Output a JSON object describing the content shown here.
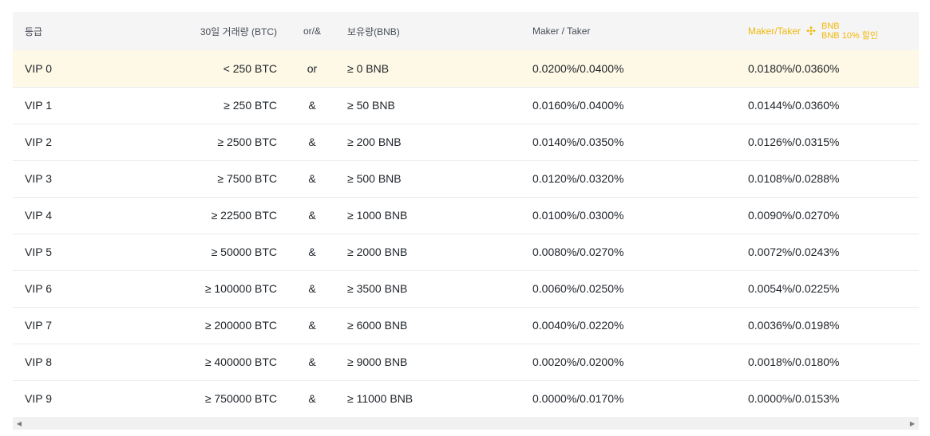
{
  "header": {
    "tier": "등급",
    "volume": "30일 거래량 (BTC)",
    "condition": "or/&",
    "holding": "보유량(BNB)",
    "maker_taker": "Maker / Taker",
    "bnb_maker_taker": "Maker/Taker",
    "bnb_line1": "BNB",
    "bnb_line2": "BNB 10% 할인"
  },
  "rows": [
    {
      "tier": "VIP 0",
      "volume": "< 250 BTC",
      "cond": "or",
      "bnb": "≥ 0 BNB",
      "fee": "0.0200%/0.0400%",
      "fee_bnb": "0.0180%/0.0360%"
    },
    {
      "tier": "VIP 1",
      "volume": "≥ 250 BTC",
      "cond": "&",
      "bnb": "≥ 50 BNB",
      "fee": "0.0160%/0.0400%",
      "fee_bnb": "0.0144%/0.0360%"
    },
    {
      "tier": "VIP 2",
      "volume": "≥ 2500 BTC",
      "cond": "&",
      "bnb": "≥ 200 BNB",
      "fee": "0.0140%/0.0350%",
      "fee_bnb": "0.0126%/0.0315%"
    },
    {
      "tier": "VIP 3",
      "volume": "≥ 7500 BTC",
      "cond": "&",
      "bnb": "≥ 500 BNB",
      "fee": "0.0120%/0.0320%",
      "fee_bnb": "0.0108%/0.0288%"
    },
    {
      "tier": "VIP 4",
      "volume": "≥ 22500 BTC",
      "cond": "&",
      "bnb": "≥ 1000 BNB",
      "fee": "0.0100%/0.0300%",
      "fee_bnb": "0.0090%/0.0270%"
    },
    {
      "tier": "VIP 5",
      "volume": "≥ 50000 BTC",
      "cond": "&",
      "bnb": "≥ 2000 BNB",
      "fee": "0.0080%/0.0270%",
      "fee_bnb": "0.0072%/0.0243%"
    },
    {
      "tier": "VIP 6",
      "volume": "≥ 100000 BTC",
      "cond": "&",
      "bnb": "≥ 3500 BNB",
      "fee": "0.0060%/0.0250%",
      "fee_bnb": "0.0054%/0.0225%"
    },
    {
      "tier": "VIP 7",
      "volume": "≥ 200000 BTC",
      "cond": "&",
      "bnb": "≥ 6000 BNB",
      "fee": "0.0040%/0.0220%",
      "fee_bnb": "0.0036%/0.0198%"
    },
    {
      "tier": "VIP 8",
      "volume": "≥ 400000 BTC",
      "cond": "&",
      "bnb": "≥ 9000 BNB",
      "fee": "0.0020%/0.0200%",
      "fee_bnb": "0.0018%/0.0180%"
    },
    {
      "tier": "VIP 9",
      "volume": "≥ 750000 BTC",
      "cond": "&",
      "bnb": "≥ 11000 BNB",
      "fee": "0.0000%/0.0170%",
      "fee_bnb": "0.0000%/0.0153%"
    }
  ],
  "colors": {
    "accent": "#f0b90b",
    "highlight_row": "#fef9e6",
    "header_bg": "#f5f5f5"
  },
  "icons": {
    "bnb": "bnb-logo-icon",
    "scroll_left": "scroll-left-arrow-icon",
    "scroll_right": "scroll-right-arrow-icon"
  }
}
